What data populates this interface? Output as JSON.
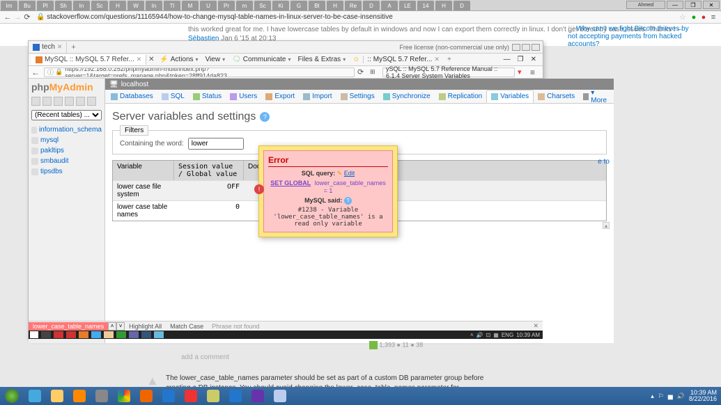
{
  "topTabs": [
    "Im",
    "Bu",
    "Pl",
    "Sh",
    "In",
    "Sc",
    "H",
    "W",
    "In",
    "Tl",
    "M",
    "U",
    "Pr",
    "m",
    "Sc",
    "Ki",
    "G",
    "BI",
    "H",
    "Re",
    "D",
    "A",
    "LE",
    "14",
    "H",
    "D"
  ],
  "browser": {
    "url": "stackoverflow.com/questions/11165944/how-to-change-mysql-table-names-in-linux-server-to-be-case-insensitive"
  },
  "so": {
    "comment_pre": "this worked great for me. I have lowercase tables by default in windows and now I can export them correctly in linux. I don't get bored by case issues. Thanks ! –",
    "comment_user": "Sébastien",
    "comment_date": "Jan 6 '15 at 20:13",
    "sidebar_q": "Why can't we fight Bitcoin thieves by not accepting payments from hacked accounts?",
    "stats": "1,393 ● 11 ● 38",
    "add_comment": "add a comment",
    "answer": "The lower_case_table_names parameter should be set as part of a custom DB parameter group before creating a DB instance. You should avoid changing the lower_case_table_names parameter for"
  },
  "ff": {
    "tab1": "tech",
    "tab2": "MySQL :: MySQL 5.7 Refer...",
    "license": "Free license (non-commercial use only)",
    "tools": {
      "actions": "Actions",
      "view": "View",
      "communicate": "Communicate",
      "files": "Files & Extras",
      "reftab": ":: MySQL 5.7 Refer..."
    },
    "url": "https://192.168.0.252/phpmyadmin-multi/index.php?server=1&target=prefs_manage.php&token=28ff914da823",
    "search": "ySQL :: MySQL 5.7 Reference Manual :: 6.1.4 Server System Variables"
  },
  "pma": {
    "logo1": "php",
    "logo2": "MyAdmin",
    "recent": "(Recent tables) ...",
    "dbs": [
      "information_schema",
      "mysql",
      "pakltips",
      "smbaudit",
      "tipsdbs"
    ],
    "breadcrumb": "localhost",
    "tabs": [
      "Databases",
      "SQL",
      "Status",
      "Users",
      "Export",
      "Import",
      "Settings",
      "Synchronize",
      "Replication",
      "Variables",
      "Charsets",
      "More"
    ],
    "active_tab": 9,
    "title": "Server variables and settings",
    "filters_legend": "Filters",
    "filter_label": "Containing the word:",
    "filter_value": "lower",
    "truncated": "e to",
    "th": {
      "variable": "Variable",
      "session": "Session value / Global value",
      "doc": "Docum"
    },
    "rows": [
      {
        "var": "lower case file system",
        "val": "OFF"
      },
      {
        "var": "lower case table names",
        "val": "0"
      }
    ]
  },
  "error": {
    "title": "Error",
    "sql_label": "SQL query:",
    "edit": "Edit",
    "sql_kw": "SET GLOBAL",
    "sql_rest": "lower_case_table_names = 1",
    "said": "MySQL said:",
    "code": "#1238 - Variable 'lower_case_table_names' is a read only variable"
  },
  "findbar": {
    "term": "lower_case_table_names",
    "highlight": "Highlight All",
    "matchcase": "Match Case",
    "notfound": "Phrase not found"
  },
  "emb_tray": {
    "lang": "ENG",
    "time": "10:39 AM"
  },
  "host_tray": {
    "time": "10:39 AM",
    "date": "8/22/2016"
  }
}
